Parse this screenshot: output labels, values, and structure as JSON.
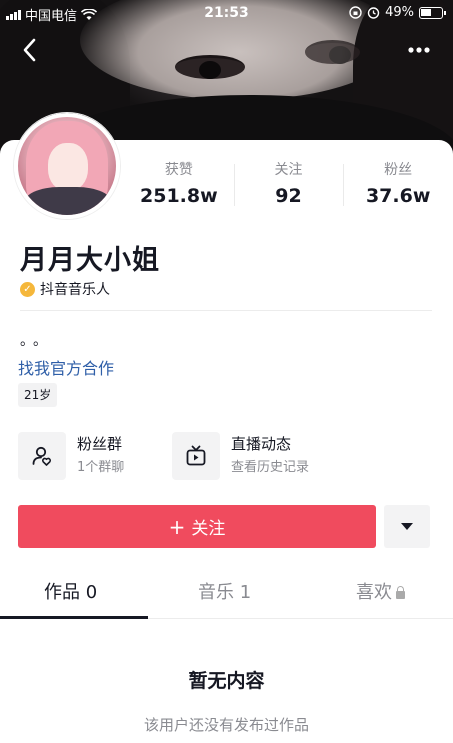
{
  "status_bar": {
    "carrier": "中国电信",
    "time": "21:53",
    "battery": "49%"
  },
  "nav": {
    "back_icon": "chevron-left-icon",
    "more_icon": "more-dots-icon"
  },
  "profile": {
    "name": "月月大小姐",
    "verified_label": "抖音音乐人",
    "bio": "。。",
    "link": "找我官方合作",
    "age_tag": "21岁"
  },
  "stats": [
    {
      "label": "获赞",
      "value": "251.8w"
    },
    {
      "label": "关注",
      "value": "92"
    },
    {
      "label": "粉丝",
      "value": "37.6w"
    }
  ],
  "features": [
    {
      "icon": "fan-group-icon",
      "title": "粉丝群",
      "subtitle": "1个群聊"
    },
    {
      "icon": "live-tv-icon",
      "title": "直播动态",
      "subtitle": "查看历史记录"
    }
  ],
  "actions": {
    "follow_label": "关注",
    "follow_plus": "+",
    "dropdown_icon": "triangle-down-icon",
    "follow_color": "#f04b5e"
  },
  "tabs": [
    {
      "label": "作品 0",
      "active": true
    },
    {
      "label": "音乐 1",
      "active": false
    },
    {
      "label": "喜欢",
      "active": false,
      "locked": true
    }
  ],
  "empty_state": {
    "title": "暂无内容",
    "subtitle": "该用户还没有发布过作品"
  }
}
